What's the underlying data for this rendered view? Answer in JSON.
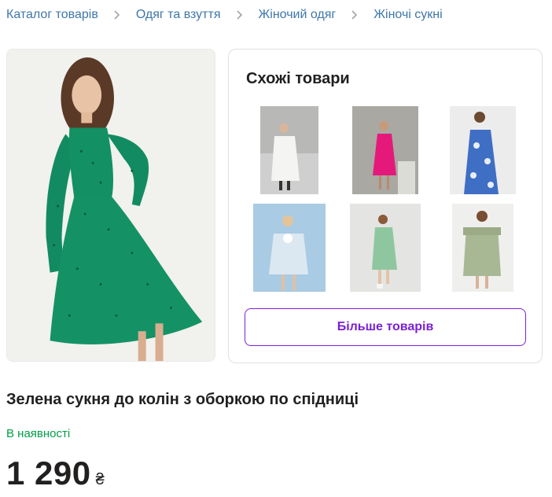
{
  "breadcrumb": [
    {
      "label": "Каталог товарів"
    },
    {
      "label": "Одяг та взуття"
    },
    {
      "label": "Жіночий одяг"
    },
    {
      "label": "Жіночі сукні"
    }
  ],
  "similar": {
    "title": "Схожі товари",
    "more_button": "Більше товарів"
  },
  "product": {
    "title": "Зелена сукня до колін з оборкою по спідниці",
    "availability": "В наявності",
    "price": "1 290",
    "currency": "₴"
  },
  "colors": {
    "link": "#3e77aa",
    "accent": "#7b1fd6",
    "in_stock": "#00a046",
    "dress_green": "#139064"
  }
}
